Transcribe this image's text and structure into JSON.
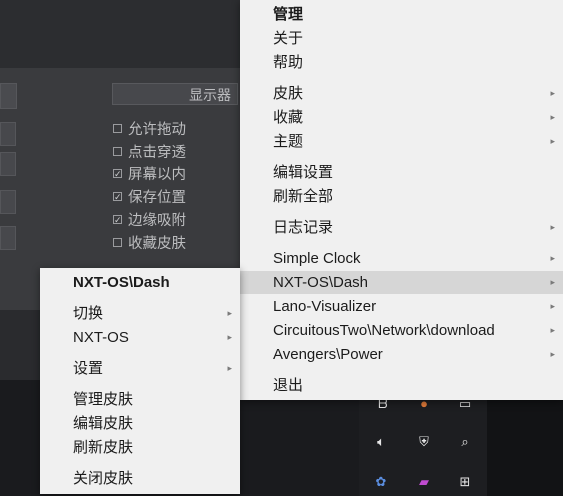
{
  "background_window": {
    "display_field_label": "显示器",
    "checkbox_options": [
      {
        "label": "允许拖动",
        "checked": false
      },
      {
        "label": "点击穿透",
        "checked": false
      },
      {
        "label": "屏幕以内",
        "checked": true
      },
      {
        "label": "保存位置",
        "checked": true
      },
      {
        "label": "边缘吸附",
        "checked": true
      },
      {
        "label": "收藏皮肤",
        "checked": false
      }
    ]
  },
  "main_menu": {
    "items": [
      {
        "label": "管理",
        "bold": true,
        "submenu": false
      },
      {
        "label": "关于",
        "submenu": false
      },
      {
        "label": "帮助",
        "submenu": false
      },
      {
        "label": "皮肤",
        "submenu": true
      },
      {
        "label": "收藏",
        "submenu": true
      },
      {
        "label": "主题",
        "submenu": true
      },
      {
        "label": "编辑设置",
        "submenu": false
      },
      {
        "label": "刷新全部",
        "submenu": false
      },
      {
        "label": "日志记录",
        "submenu": true
      },
      {
        "label": "Simple Clock",
        "submenu": true
      },
      {
        "label": "NXT-OS\\Dash",
        "submenu": true,
        "highlighted": true
      },
      {
        "label": "Lano-Visualizer",
        "submenu": true
      },
      {
        "label": "CircuitousTwo\\Network\\download",
        "submenu": true
      },
      {
        "label": "Avengers\\Power",
        "submenu": true
      },
      {
        "label": "退出",
        "submenu": false
      }
    ]
  },
  "sub_menu": {
    "items": [
      {
        "label": "NXT-OS\\Dash",
        "bold": true,
        "submenu": false
      },
      {
        "label": "切换",
        "submenu": true
      },
      {
        "label": "NXT-OS",
        "submenu": true
      },
      {
        "label": "设置",
        "submenu": true
      },
      {
        "label": "管理皮肤",
        "submenu": false
      },
      {
        "label": "编辑皮肤",
        "submenu": false
      },
      {
        "label": "刷新皮肤",
        "submenu": false
      },
      {
        "label": "关闭皮肤",
        "submenu": false
      }
    ]
  },
  "tray_icons": [
    "app-icon",
    "photo-icon",
    "window-icon",
    "volume-icon",
    "security-icon",
    "search-icon",
    "baidu-icon",
    "game-icon",
    "windows-icon"
  ]
}
